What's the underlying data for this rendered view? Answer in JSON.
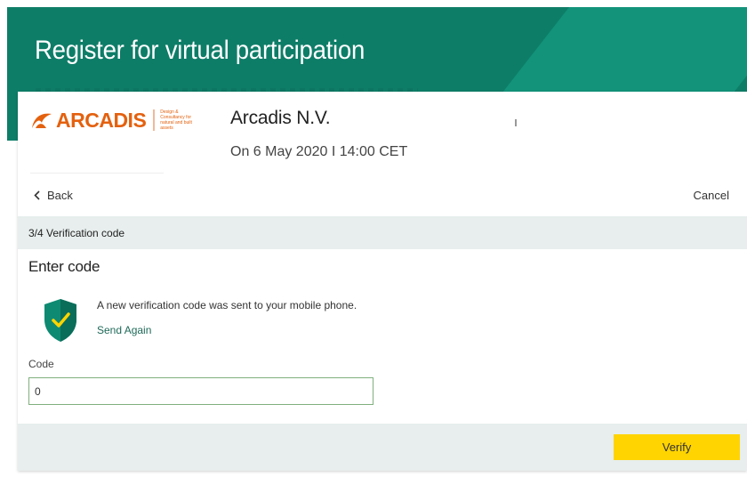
{
  "header": {
    "title": "Register for virtual participation"
  },
  "event": {
    "logo_text": "ARCADIS",
    "logo_tagline": "Design & Consultancy for natural and built assets",
    "company": "Arcadis N.V.",
    "date": "On 6 May 2020 I 14:00 CET"
  },
  "nav": {
    "back_label": "Back",
    "cancel_label": "Cancel"
  },
  "step": {
    "label": "3/4 Verification code"
  },
  "form": {
    "section_title": "Enter code",
    "notice": "A new verification code was sent to your mobile phone.",
    "send_again_label": "Send Again",
    "code_label": "Code",
    "code_value": "0",
    "verify_label": "Verify"
  },
  "colors": {
    "header_green": "#0e7d68",
    "logo_orange": "#e4610f",
    "link_green": "#1f6a58",
    "verify_yellow": "#ffd400",
    "step_bar": "#e7eeed",
    "input_border": "#7fb07e"
  },
  "icons": {
    "back": "chevron-left-icon",
    "shield": "shield-check-icon",
    "logo": "arcadis-logo-icon"
  }
}
